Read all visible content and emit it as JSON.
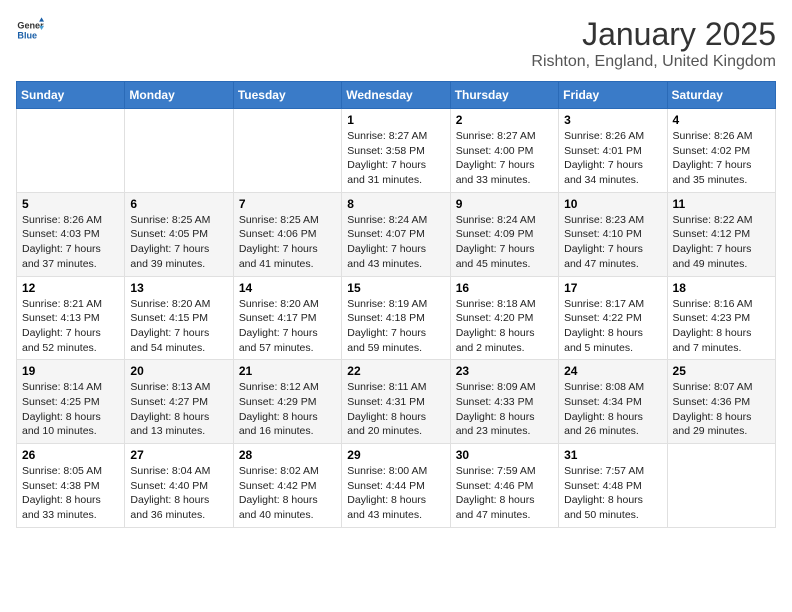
{
  "logo": {
    "general": "General",
    "blue": "Blue"
  },
  "header": {
    "month": "January 2025",
    "location": "Rishton, England, United Kingdom"
  },
  "days_of_week": [
    "Sunday",
    "Monday",
    "Tuesday",
    "Wednesday",
    "Thursday",
    "Friday",
    "Saturday"
  ],
  "weeks": [
    [
      {
        "day": "",
        "content": ""
      },
      {
        "day": "",
        "content": ""
      },
      {
        "day": "",
        "content": ""
      },
      {
        "day": "1",
        "content": "Sunrise: 8:27 AM\nSunset: 3:58 PM\nDaylight: 7 hours\nand 31 minutes."
      },
      {
        "day": "2",
        "content": "Sunrise: 8:27 AM\nSunset: 4:00 PM\nDaylight: 7 hours\nand 33 minutes."
      },
      {
        "day": "3",
        "content": "Sunrise: 8:26 AM\nSunset: 4:01 PM\nDaylight: 7 hours\nand 34 minutes."
      },
      {
        "day": "4",
        "content": "Sunrise: 8:26 AM\nSunset: 4:02 PM\nDaylight: 7 hours\nand 35 minutes."
      }
    ],
    [
      {
        "day": "5",
        "content": "Sunrise: 8:26 AM\nSunset: 4:03 PM\nDaylight: 7 hours\nand 37 minutes."
      },
      {
        "day": "6",
        "content": "Sunrise: 8:25 AM\nSunset: 4:05 PM\nDaylight: 7 hours\nand 39 minutes."
      },
      {
        "day": "7",
        "content": "Sunrise: 8:25 AM\nSunset: 4:06 PM\nDaylight: 7 hours\nand 41 minutes."
      },
      {
        "day": "8",
        "content": "Sunrise: 8:24 AM\nSunset: 4:07 PM\nDaylight: 7 hours\nand 43 minutes."
      },
      {
        "day": "9",
        "content": "Sunrise: 8:24 AM\nSunset: 4:09 PM\nDaylight: 7 hours\nand 45 minutes."
      },
      {
        "day": "10",
        "content": "Sunrise: 8:23 AM\nSunset: 4:10 PM\nDaylight: 7 hours\nand 47 minutes."
      },
      {
        "day": "11",
        "content": "Sunrise: 8:22 AM\nSunset: 4:12 PM\nDaylight: 7 hours\nand 49 minutes."
      }
    ],
    [
      {
        "day": "12",
        "content": "Sunrise: 8:21 AM\nSunset: 4:13 PM\nDaylight: 7 hours\nand 52 minutes."
      },
      {
        "day": "13",
        "content": "Sunrise: 8:20 AM\nSunset: 4:15 PM\nDaylight: 7 hours\nand 54 minutes."
      },
      {
        "day": "14",
        "content": "Sunrise: 8:20 AM\nSunset: 4:17 PM\nDaylight: 7 hours\nand 57 minutes."
      },
      {
        "day": "15",
        "content": "Sunrise: 8:19 AM\nSunset: 4:18 PM\nDaylight: 7 hours\nand 59 minutes."
      },
      {
        "day": "16",
        "content": "Sunrise: 8:18 AM\nSunset: 4:20 PM\nDaylight: 8 hours\nand 2 minutes."
      },
      {
        "day": "17",
        "content": "Sunrise: 8:17 AM\nSunset: 4:22 PM\nDaylight: 8 hours\nand 5 minutes."
      },
      {
        "day": "18",
        "content": "Sunrise: 8:16 AM\nSunset: 4:23 PM\nDaylight: 8 hours\nand 7 minutes."
      }
    ],
    [
      {
        "day": "19",
        "content": "Sunrise: 8:14 AM\nSunset: 4:25 PM\nDaylight: 8 hours\nand 10 minutes."
      },
      {
        "day": "20",
        "content": "Sunrise: 8:13 AM\nSunset: 4:27 PM\nDaylight: 8 hours\nand 13 minutes."
      },
      {
        "day": "21",
        "content": "Sunrise: 8:12 AM\nSunset: 4:29 PM\nDaylight: 8 hours\nand 16 minutes."
      },
      {
        "day": "22",
        "content": "Sunrise: 8:11 AM\nSunset: 4:31 PM\nDaylight: 8 hours\nand 20 minutes."
      },
      {
        "day": "23",
        "content": "Sunrise: 8:09 AM\nSunset: 4:33 PM\nDaylight: 8 hours\nand 23 minutes."
      },
      {
        "day": "24",
        "content": "Sunrise: 8:08 AM\nSunset: 4:34 PM\nDaylight: 8 hours\nand 26 minutes."
      },
      {
        "day": "25",
        "content": "Sunrise: 8:07 AM\nSunset: 4:36 PM\nDaylight: 8 hours\nand 29 minutes."
      }
    ],
    [
      {
        "day": "26",
        "content": "Sunrise: 8:05 AM\nSunset: 4:38 PM\nDaylight: 8 hours\nand 33 minutes."
      },
      {
        "day": "27",
        "content": "Sunrise: 8:04 AM\nSunset: 4:40 PM\nDaylight: 8 hours\nand 36 minutes."
      },
      {
        "day": "28",
        "content": "Sunrise: 8:02 AM\nSunset: 4:42 PM\nDaylight: 8 hours\nand 40 minutes."
      },
      {
        "day": "29",
        "content": "Sunrise: 8:00 AM\nSunset: 4:44 PM\nDaylight: 8 hours\nand 43 minutes."
      },
      {
        "day": "30",
        "content": "Sunrise: 7:59 AM\nSunset: 4:46 PM\nDaylight: 8 hours\nand 47 minutes."
      },
      {
        "day": "31",
        "content": "Sunrise: 7:57 AM\nSunset: 4:48 PM\nDaylight: 8 hours\nand 50 minutes."
      },
      {
        "day": "",
        "content": ""
      }
    ]
  ]
}
